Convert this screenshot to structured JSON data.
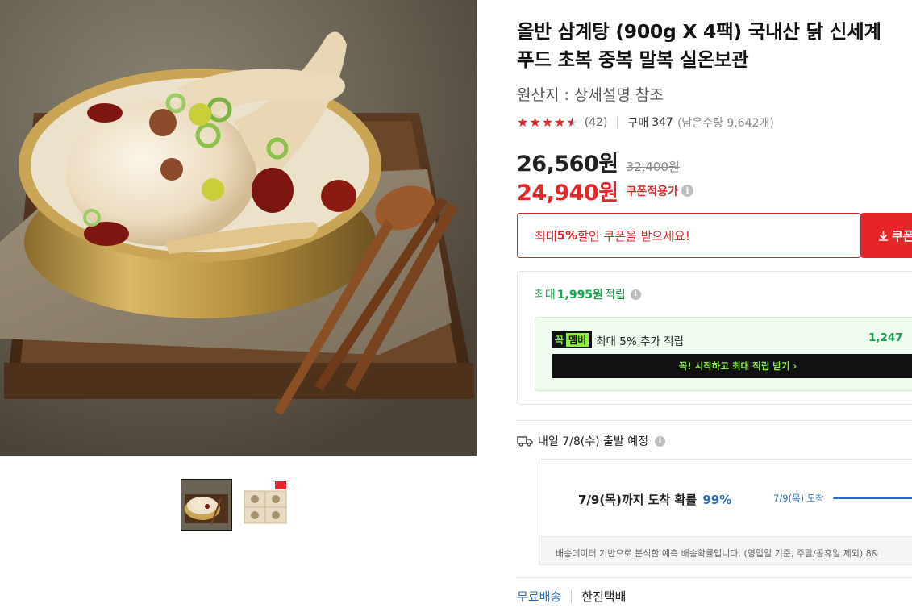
{
  "product": {
    "title": "올반 삼계탕 (900g X 4팩) 국내산 닭 신세계 푸드 초복 중복 말복 실온보관",
    "origin": "원산지 : 상세설명 참조",
    "rating": 4.5,
    "review_count": "(42)",
    "purchase_label": "구매",
    "purchase_count": "347",
    "remaining": "(남은수량 9,642개)"
  },
  "images": {
    "main_alt": "삼계탕",
    "thumbnails": [
      {
        "name": "samgyetang-bowl",
        "selected": true
      },
      {
        "name": "samgyetang-packs",
        "selected": false
      }
    ]
  },
  "price": {
    "sale": "26,560원",
    "original": "32,400원",
    "coupon_price": "24,940원",
    "coupon_applied_label": "쿠폰적용가"
  },
  "coupon": {
    "banner_prefix": "최대 ",
    "banner_highlight": "5%",
    "banner_suffix": " 할인 쿠폰을 받으세요!",
    "button_label": "쿠폰"
  },
  "points": {
    "prefix": "최대",
    "amount": "1,995원",
    "suffix": "적립",
    "member_badge_1": "꼭",
    "member_badge_2": "멤버",
    "member_text": "최대 5% 추가 적립",
    "member_amount": "1,247",
    "member_cta": "꼭! 시작하고 최대 적립 받기 ›"
  },
  "shipping": {
    "departure": "내일 7/8(수) 출발 예정",
    "probability_text": "7/9(목)까지 도착 확률",
    "probability_pct": "99%",
    "probability_value": 0.99,
    "arrival_label": "7/9(목) 도착",
    "note": "배송데이터 기반으로 분석한 예측 배송확률입니다. (영업일 기준, 주말/공휴일 제외) 8&",
    "free_shipping": "무료배송",
    "carrier": "한진택배"
  },
  "colors": {
    "accent_red": "#e52528",
    "points_green": "#16a34a",
    "member_lime": "#8af03a",
    "link_blue": "#2e6bbf"
  }
}
